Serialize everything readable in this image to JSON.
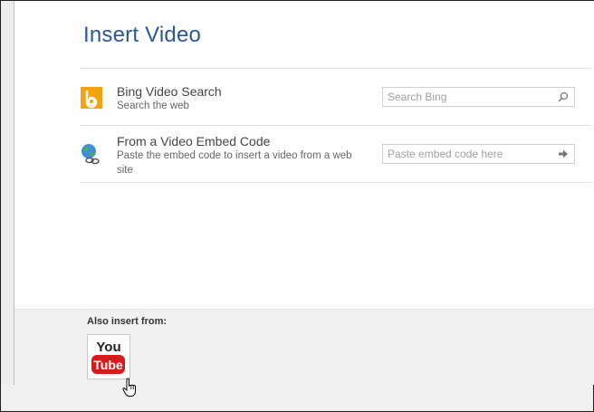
{
  "dialog": {
    "title": "Insert Video"
  },
  "rows": [
    {
      "title": "Bing Video Search",
      "subtitle": "Search the web",
      "input_placeholder": "Search Bing",
      "icon": "bing-icon",
      "button_icon": "search-icon"
    },
    {
      "title": "From a Video Embed Code",
      "subtitle_line1": "Paste the embed code to insert a video from a web",
      "subtitle_line2": "site",
      "input_placeholder": "Paste embed code here",
      "icon": "globe-link-icon",
      "button_icon": "arrow-right-icon"
    }
  ],
  "footer": {
    "label": "Also insert from:",
    "sources": [
      {
        "name": "YouTube",
        "text_top": "You",
        "text_bottom": "Tube"
      }
    ]
  },
  "colors": {
    "title": "#2b579a",
    "bing_orange": "#f2a30f",
    "youtube_red": "#d51b1b"
  }
}
